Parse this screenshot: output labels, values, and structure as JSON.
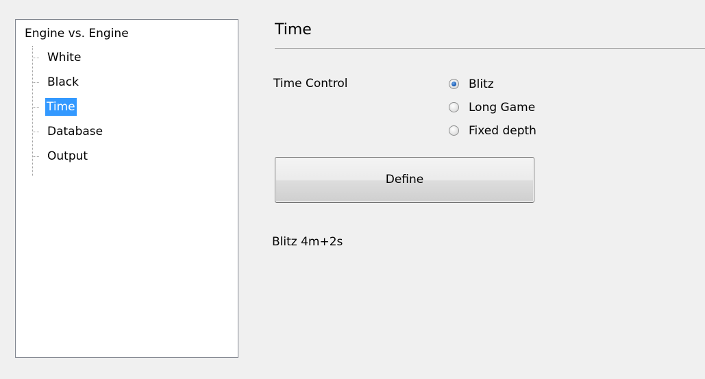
{
  "tree": {
    "root": "Engine vs. Engine",
    "items": [
      {
        "label": "White",
        "selected": false
      },
      {
        "label": "Black",
        "selected": false
      },
      {
        "label": "Time",
        "selected": true
      },
      {
        "label": "Database",
        "selected": false
      },
      {
        "label": "Output",
        "selected": false
      }
    ]
  },
  "section": {
    "title": "Time"
  },
  "time_control": {
    "label": "Time Control",
    "options": [
      {
        "label": "Blitz",
        "checked": true
      },
      {
        "label": "Long Game",
        "checked": false
      },
      {
        "label": "Fixed depth",
        "checked": false
      }
    ]
  },
  "buttons": {
    "define_label": "Define"
  },
  "summary": "Blitz 4m+2s",
  "colors": {
    "selection": "#3399ff",
    "background": "#f0f0f0",
    "tree_border": "#828790"
  }
}
